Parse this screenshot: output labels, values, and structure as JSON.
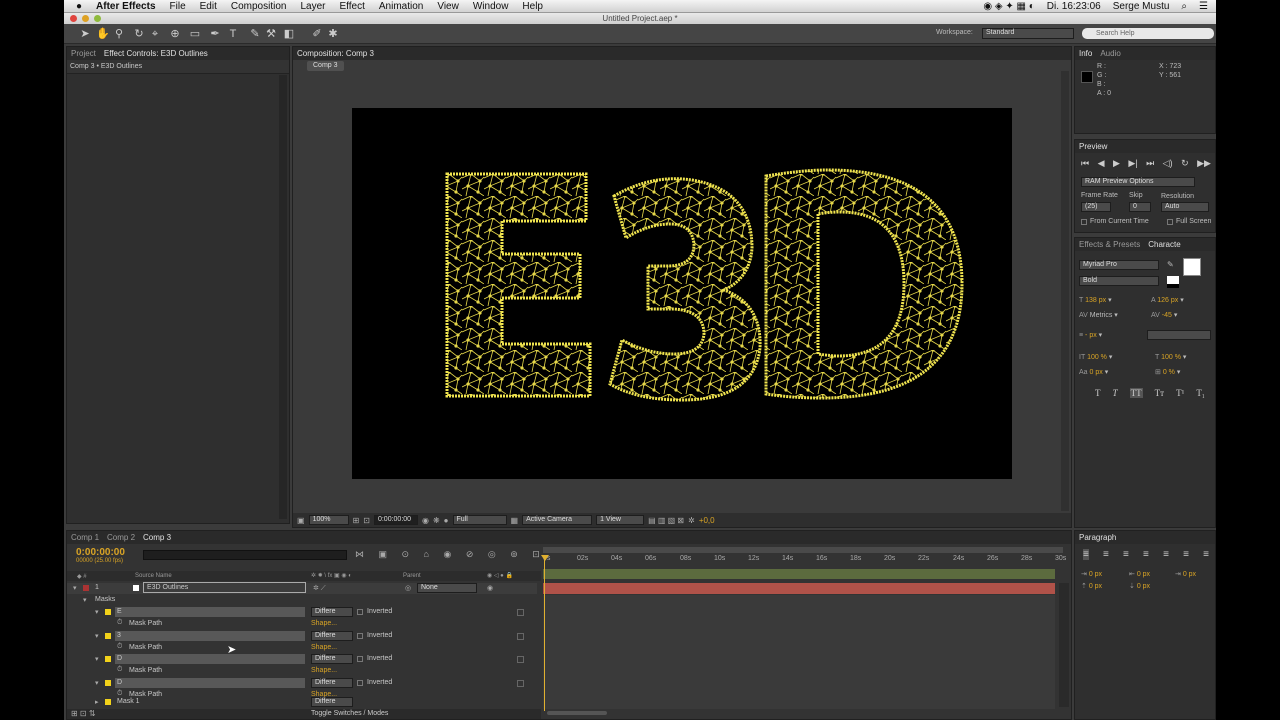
{
  "menubar": {
    "app": "After Effects",
    "items": [
      "File",
      "Edit",
      "Composition",
      "Layer",
      "Effect",
      "Animation",
      "View",
      "Window",
      "Help"
    ],
    "clock": "Di. 16:23:06",
    "user": "Serge Mustu"
  },
  "window": {
    "title": "Untitled Project.aep *"
  },
  "toolbar": {
    "workspace_label": "Workspace:",
    "workspace_value": "Standard",
    "search_placeholder": "Search Help"
  },
  "left_panel": {
    "tab_project": "Project",
    "tab_effect": "Effect Controls: E3D Outlines",
    "breadcrumb": "Comp 3 • E3D Outlines"
  },
  "composition": {
    "tab": "Composition: Comp 3",
    "subtab": "Comp 3",
    "text": "E3D",
    "zoom": "100%",
    "timecode": "0:00:00:00",
    "resolution": "Full",
    "camera": "Active Camera",
    "view": "1 View",
    "exposure": "+0,0"
  },
  "info": {
    "tab_info": "Info",
    "tab_audio": "Audio",
    "r": "R :",
    "g": "G :",
    "b": "B :",
    "a": "A : 0",
    "x": "X : 723",
    "y": "Y : 561"
  },
  "preview": {
    "tab": "Preview",
    "ram": "RAM Preview Options",
    "frame_rate_label": "Frame Rate",
    "skip_label": "Skip",
    "resolution_label": "Resolution",
    "frame_rate": "(25)",
    "skip": "0",
    "resolution": "Auto",
    "from_current": "From Current Time",
    "full_screen": "Full Screen"
  },
  "character": {
    "tab_effects": "Effects & Presets",
    "tab_char": "Characte",
    "font": "Myriad Pro",
    "style": "Bold",
    "size": "138 px",
    "leading": "126 px",
    "kerning": "Metrics",
    "tracking": "-45",
    "stroke": "- px",
    "vscale": "100 %",
    "hscale": "100 %",
    "baseline": "0 px",
    "tsume": "0 %",
    "styles": [
      "T",
      "T",
      "TT",
      "Tт",
      "T¹",
      "T₁"
    ]
  },
  "paragraph": {
    "tab": "Paragraph",
    "values": [
      "0 px",
      "0 px",
      "0 px",
      "0 px",
      "0 px"
    ]
  },
  "timeline": {
    "tabs": [
      "Comp 1",
      "Comp 2",
      "Comp 3"
    ],
    "timecode": "0:00:00:00",
    "fps": "00000 (25.00 fps)",
    "col_source": "Source Name",
    "col_parent": "Parent",
    "layer_num": "1",
    "layer_name": "E3D Outlines",
    "parent_value": "None",
    "masks_label": "Masks",
    "mode": "Differe",
    "inverted": "Inverted",
    "mask_path": "Mask Path",
    "shape": "Shape...",
    "mask_names": [
      "E",
      "3",
      "D",
      "D"
    ],
    "mask1": "Mask 1",
    "toggle": "Toggle Switches / Modes",
    "ticks": [
      "0s",
      "02s",
      "04s",
      "06s",
      "08s",
      "10s",
      "12s",
      "14s",
      "16s",
      "18s",
      "20s",
      "22s",
      "24s",
      "26s",
      "28s",
      "30s"
    ]
  }
}
